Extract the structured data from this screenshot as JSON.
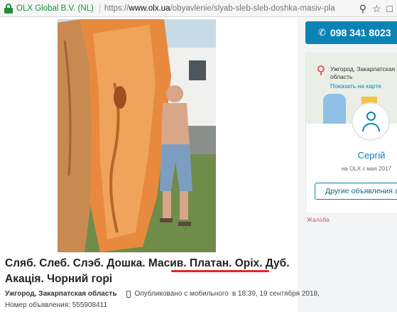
{
  "browser": {
    "site_identity": "OLX Global B.V. (NL)",
    "url_scheme": "https://",
    "url_host": "www.olx.ua",
    "url_path": "/obyavlenie/slyab-sleb-sleb-doshka-masiv-pla",
    "icons": [
      "lock-icon",
      "key-icon",
      "star-icon",
      "bookmark-icon"
    ]
  },
  "listing": {
    "title_line1_part1": "Сляб. Слеб. Слэб. Дошка. Масив. ",
    "title_line1_part2": "Платан. Оріх. Дуб.",
    "title_line2": "Акація. Чорний горі",
    "city": "Ужгород, Закарпатская область",
    "published_label": "Опубликовано с мобильного",
    "published_time": "в 18:39, 19 сентября 2018,",
    "ad_number_label": "Номер объявления: 555908411"
  },
  "contact": {
    "phone": "098 341 8023",
    "map_location": "Ужгород, Закарпатская область",
    "map_link": "Показать на карте",
    "user_name": "Сергій",
    "member_since": "на OLX с мая 2017",
    "other_ads_label": "Другие объявления ав",
    "complaint_label": "Жалоба"
  },
  "colors": {
    "accent": "#0a83b5",
    "underline": "#e8232b"
  }
}
